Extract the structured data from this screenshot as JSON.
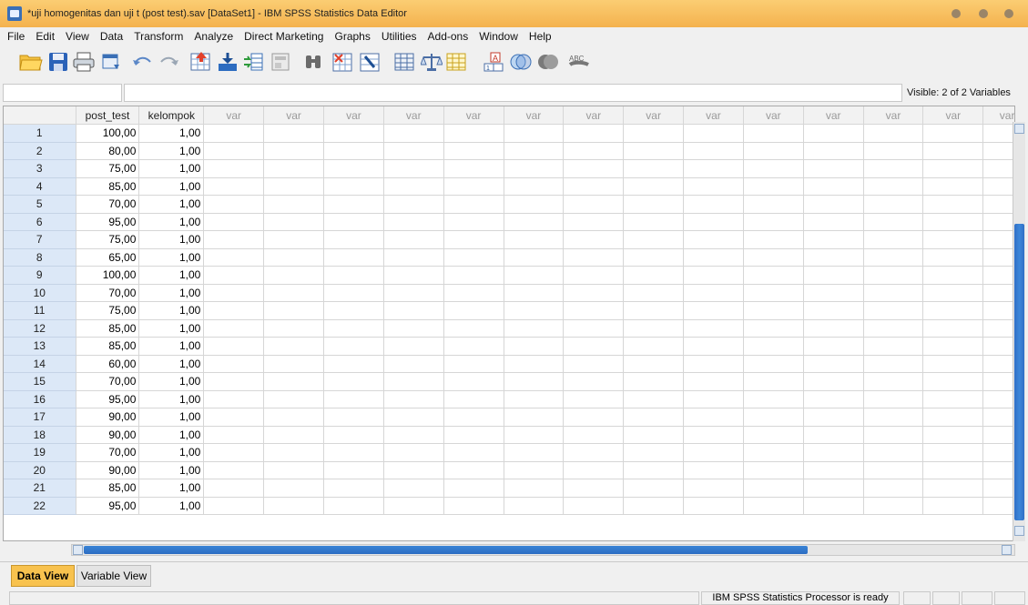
{
  "window": {
    "title": "*uji homogenitas dan uji t (post test).sav [DataSet1] - IBM SPSS Statistics Data Editor"
  },
  "menu": [
    "File",
    "Edit",
    "View",
    "Data",
    "Transform",
    "Analyze",
    "Direct Marketing",
    "Graphs",
    "Utilities",
    "Add-ons",
    "Window",
    "Help"
  ],
  "toolbar": {
    "icons": [
      "open-data-icon",
      "save-icon",
      "print-icon",
      "recall-dialog-icon",
      "undo-icon",
      "redo-icon",
      "goto-case-icon",
      "goto-variable-icon",
      "variables-icon",
      "run-descriptives-icon",
      "find-icon",
      "insert-cases-icon",
      "insert-variable-icon",
      "split-file-icon",
      "weight-cases-icon",
      "select-cases-icon",
      "value-labels-icon",
      "use-sets-icon",
      "show-all-variables-icon",
      "spelling-icon"
    ],
    "spelling_label": "ABC"
  },
  "editor": {
    "cell_ref": "",
    "cell_value": "",
    "visible_label": "Visible: 2 of 2 Variables"
  },
  "grid": {
    "columns": [
      "post_test",
      "kelompok",
      "var",
      "var",
      "var",
      "var",
      "var",
      "var",
      "var",
      "var",
      "var",
      "var",
      "var",
      "var",
      "var",
      "var"
    ],
    "rows": [
      {
        "n": "1",
        "post_test": "100,00",
        "kelompok": "1,00"
      },
      {
        "n": "2",
        "post_test": "80,00",
        "kelompok": "1,00"
      },
      {
        "n": "3",
        "post_test": "75,00",
        "kelompok": "1,00"
      },
      {
        "n": "4",
        "post_test": "85,00",
        "kelompok": "1,00"
      },
      {
        "n": "5",
        "post_test": "70,00",
        "kelompok": "1,00"
      },
      {
        "n": "6",
        "post_test": "95,00",
        "kelompok": "1,00"
      },
      {
        "n": "7",
        "post_test": "75,00",
        "kelompok": "1,00"
      },
      {
        "n": "8",
        "post_test": "65,00",
        "kelompok": "1,00"
      },
      {
        "n": "9",
        "post_test": "100,00",
        "kelompok": "1,00"
      },
      {
        "n": "10",
        "post_test": "70,00",
        "kelompok": "1,00"
      },
      {
        "n": "11",
        "post_test": "75,00",
        "kelompok": "1,00"
      },
      {
        "n": "12",
        "post_test": "85,00",
        "kelompok": "1,00"
      },
      {
        "n": "13",
        "post_test": "85,00",
        "kelompok": "1,00"
      },
      {
        "n": "14",
        "post_test": "60,00",
        "kelompok": "1,00"
      },
      {
        "n": "15",
        "post_test": "70,00",
        "kelompok": "1,00"
      },
      {
        "n": "16",
        "post_test": "95,00",
        "kelompok": "1,00"
      },
      {
        "n": "17",
        "post_test": "90,00",
        "kelompok": "1,00"
      },
      {
        "n": "18",
        "post_test": "90,00",
        "kelompok": "1,00"
      },
      {
        "n": "19",
        "post_test": "70,00",
        "kelompok": "1,00"
      },
      {
        "n": "20",
        "post_test": "90,00",
        "kelompok": "1,00"
      },
      {
        "n": "21",
        "post_test": "85,00",
        "kelompok": "1,00"
      },
      {
        "n": "22",
        "post_test": "95,00",
        "kelompok": "1,00"
      }
    ]
  },
  "tabs": {
    "data_view": "Data View",
    "variable_view": "Variable View",
    "active": "Data View"
  },
  "status": {
    "text": "IBM SPSS Statistics Processor is ready"
  },
  "colors": {
    "title_bar": "#f4b24e",
    "active_tab": "#f8c24e",
    "row_header": "#dce8f7",
    "scroll_thumb": "#2f6fc6"
  }
}
